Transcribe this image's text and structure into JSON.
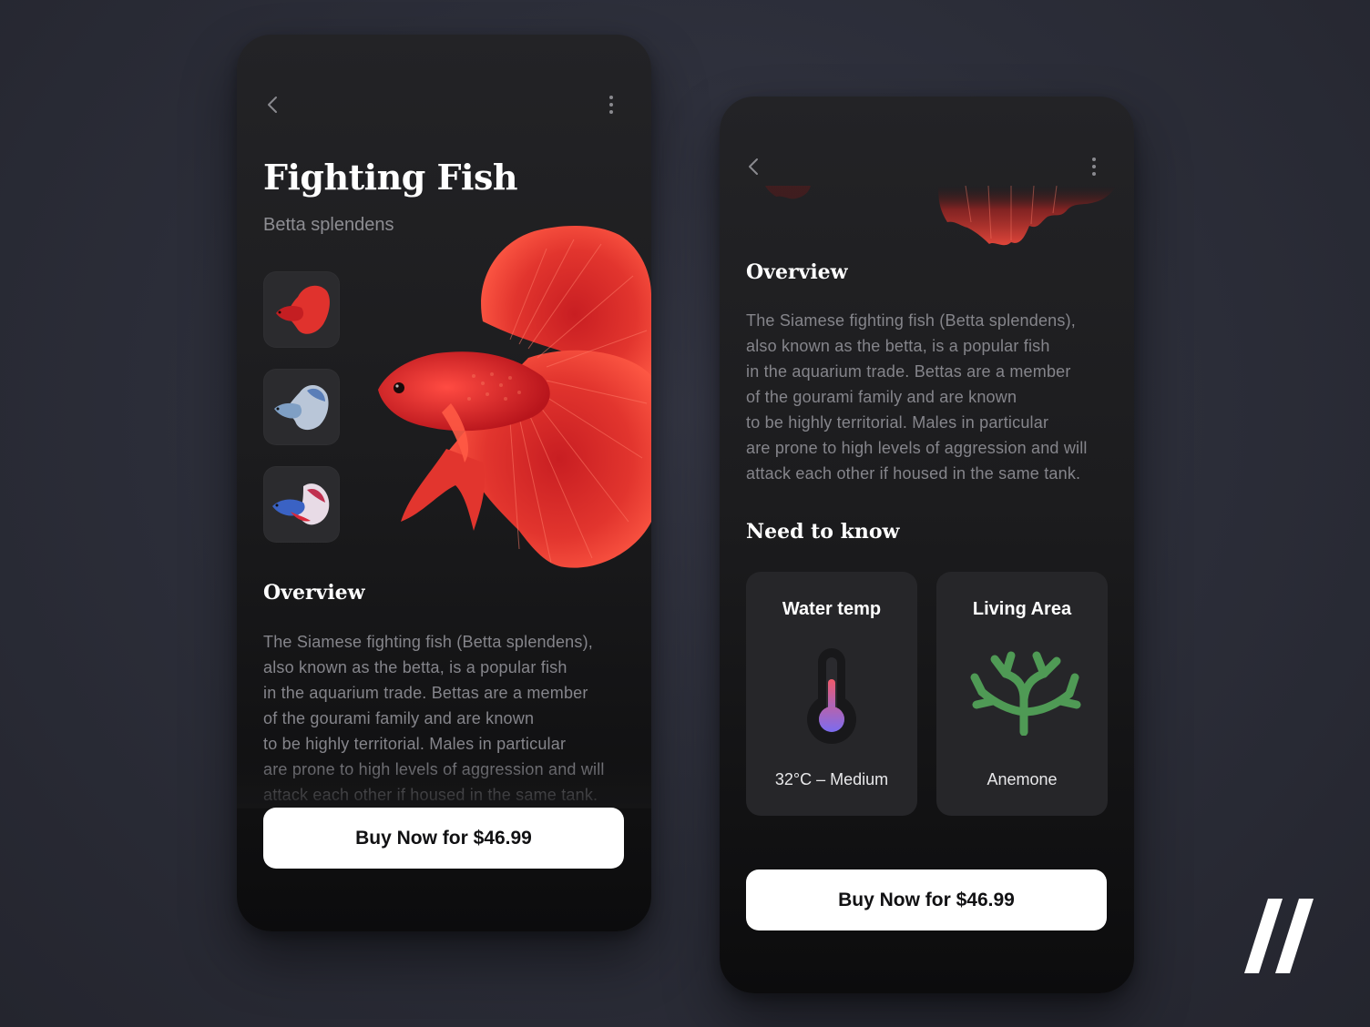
{
  "product": {
    "title": "Fighting Fish",
    "scientific_name": "Betta splendens",
    "price_label": "Buy Now for $46.99"
  },
  "overview": {
    "heading": "Overview",
    "lines": [
      "The Siamese fighting fish (Betta splendens),",
      "also known as the betta, is a popular fish",
      "in the aquarium trade. Bettas are a member",
      "of the gourami family and are known",
      "to be highly territorial. Males in particular",
      "are prone to high levels of aggression and will",
      "attack each other if housed in the same tank."
    ]
  },
  "need_to_know": {
    "heading": "Need to know",
    "cards": [
      {
        "title": "Water temp",
        "value": "32°C – Medium",
        "icon": "thermometer-icon"
      },
      {
        "title": "Living Area",
        "value": "Anemone",
        "icon": "coral-icon"
      }
    ]
  },
  "thumbnails": [
    {
      "name": "red-betta",
      "color": "#d92a2a"
    },
    {
      "name": "blue-white-betta",
      "color": "#7f9fc4"
    },
    {
      "name": "blue-red-betta",
      "color": "#3a62c4"
    }
  ],
  "icons": {
    "back": "chevron-left-icon",
    "more": "more-vertical-icon"
  },
  "colors": {
    "background": "#2b2d38",
    "card": "#262629",
    "fish_red": "#e0322d",
    "coral_green": "#4f9a55",
    "button": "#ffffff"
  }
}
